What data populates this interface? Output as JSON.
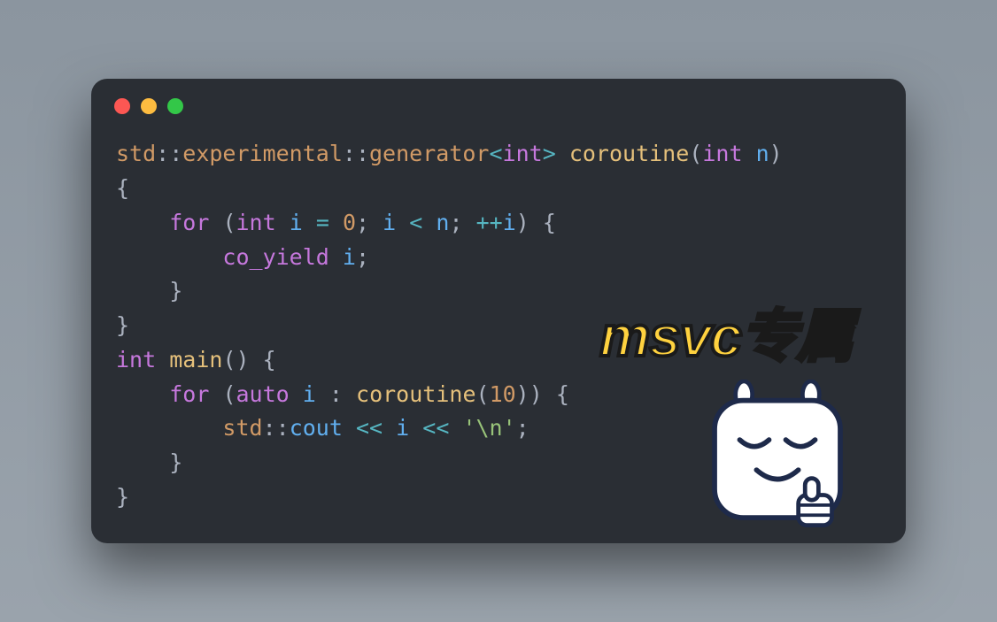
{
  "titlebar": {
    "dots": [
      "red",
      "yellow",
      "green"
    ]
  },
  "code": {
    "line1": {
      "ns1": "std",
      "cc1": "::",
      "ns2": "experimental",
      "cc2": "::",
      "ns3": "generator",
      "lt": "<",
      "type1": "int",
      "gt": ">",
      "sp1": " ",
      "fn1": "coroutine",
      "lp": "(",
      "type2": "int",
      "sp2": " ",
      "arg": "n",
      "rp": ")"
    },
    "line2": "{",
    "line3": {
      "indent": "    ",
      "for": "for",
      "sp1": " ",
      "lp": "(",
      "type": "int",
      "sp2": " ",
      "var": "i",
      "sp3": " ",
      "eq": "=",
      "sp4": " ",
      "zero": "0",
      "semi1": ";",
      "sp5": " ",
      "var2": "i",
      "sp6": " ",
      "lt": "<",
      "sp7": " ",
      "n": "n",
      "semi2": ";",
      "sp8": " ",
      "inc": "++",
      "var3": "i",
      "rp": ")",
      "sp9": " ",
      "lb": "{"
    },
    "line4": {
      "indent": "        ",
      "coyield": "co_yield",
      "sp": " ",
      "var": "i",
      "semi": ";"
    },
    "line5": "    }",
    "line6": "}",
    "line7": {
      "type": "int",
      "sp1": " ",
      "fn": "main",
      "parens": "()",
      "sp2": " ",
      "lb": "{"
    },
    "line8": {
      "indent": "    ",
      "for": "for",
      "sp1": " ",
      "lp": "(",
      "auto": "auto",
      "sp2": " ",
      "var": "i",
      "sp3": " ",
      "colon": ":",
      "sp4": " ",
      "fn": "coroutine",
      "lp2": "(",
      "num": "10",
      "rp2": ")",
      "rp": ")",
      "sp5": " ",
      "lb": "{"
    },
    "line9": {
      "indent": "        ",
      "ns": "std",
      "cc": "::",
      "cout": "cout",
      "sp1": " ",
      "op1": "<<",
      "sp2": " ",
      "var": "i",
      "sp3": " ",
      "op2": "<<",
      "sp4": " ",
      "str": "'\\n'",
      "semi": ";"
    },
    "line10": "    }",
    "line11": "}"
  },
  "overlay": "msvc专属"
}
